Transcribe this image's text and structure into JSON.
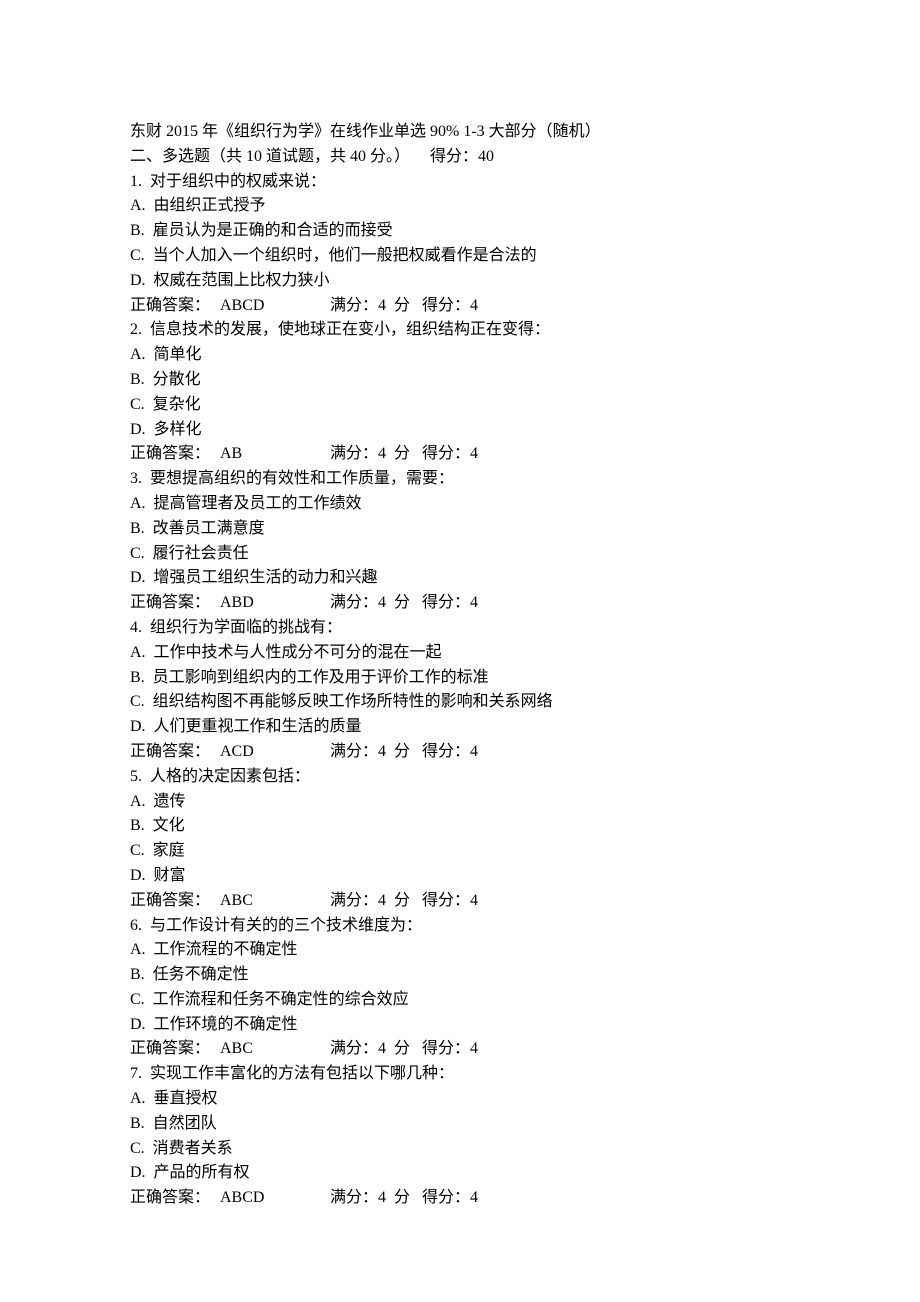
{
  "header": {
    "title": "东财 2015 年《组织行为学》在线作业单选 90% 1-3 大部分（随机）",
    "section": "二、多选题（共 10 道试题，共 40 分。）     得分：40"
  },
  "questions": [
    {
      "num": "1.",
      "stem": "  对于组织中的权威来说：",
      "options": [
        "A.  由组织正式授予",
        "B.  雇员认为是正确的和合适的而接受",
        "C.  当个人加入一个组织时，他们一般把权威看作是合法的",
        "D.  权威在范围上比权力狭小"
      ],
      "answer_label": "正确答案：",
      "answer": "ABCD",
      "score_label": "满分：4  分   得分：4"
    },
    {
      "num": "2.",
      "stem": "  信息技术的发展，使地球正在变小，组织结构正在变得：",
      "options": [
        "A.  简单化",
        "B.  分散化",
        "C.  复杂化",
        "D.  多样化"
      ],
      "answer_label": "正确答案：",
      "answer": "AB",
      "score_label": "满分：4  分   得分：4"
    },
    {
      "num": "3.",
      "stem": "  要想提高组织的有效性和工作质量，需要：",
      "options": [
        "A.  提高管理者及员工的工作绩效",
        "B.  改善员工满意度",
        "C.  履行社会责任",
        "D.  增强员工组织生活的动力和兴趣"
      ],
      "answer_label": "正确答案：",
      "answer": "ABD",
      "score_label": "满分：4  分   得分：4"
    },
    {
      "num": "4.",
      "stem": "  组织行为学面临的挑战有：",
      "options": [
        "A.  工作中技术与人性成分不可分的混在一起",
        "B.  员工影响到组织内的工作及用于评价工作的标准",
        "C.  组织结构图不再能够反映工作场所特性的影响和关系网络",
        "D.  人们更重视工作和生活的质量"
      ],
      "answer_label": "正确答案：",
      "answer": "ACD",
      "score_label": "满分：4  分   得分：4"
    },
    {
      "num": "5.",
      "stem": "  人格的决定因素包括：",
      "options": [
        "A.  遗传",
        "B.  文化",
        "C.  家庭",
        "D.  财富"
      ],
      "answer_label": "正确答案：",
      "answer": "ABC",
      "score_label": "满分：4  分   得分：4"
    },
    {
      "num": "6.",
      "stem": "  与工作设计有关的的三个技术维度为：",
      "options": [
        "A.  工作流程的不确定性",
        "B.  任务不确定性",
        "C.  工作流程和任务不确定性的综合效应",
        "D.  工作环境的不确定性"
      ],
      "answer_label": "正确答案：",
      "answer": "ABC",
      "score_label": "满分：4  分   得分：4"
    },
    {
      "num": "7.",
      "stem": "  实现工作丰富化的方法有包括以下哪几种：",
      "options": [
        "A.  垂直授权",
        "B.  自然团队",
        "C.  消费者关系",
        "D.  产品的所有权"
      ],
      "answer_label": "正确答案：",
      "answer": "ABCD",
      "score_label": "满分：4  分   得分：4"
    }
  ]
}
